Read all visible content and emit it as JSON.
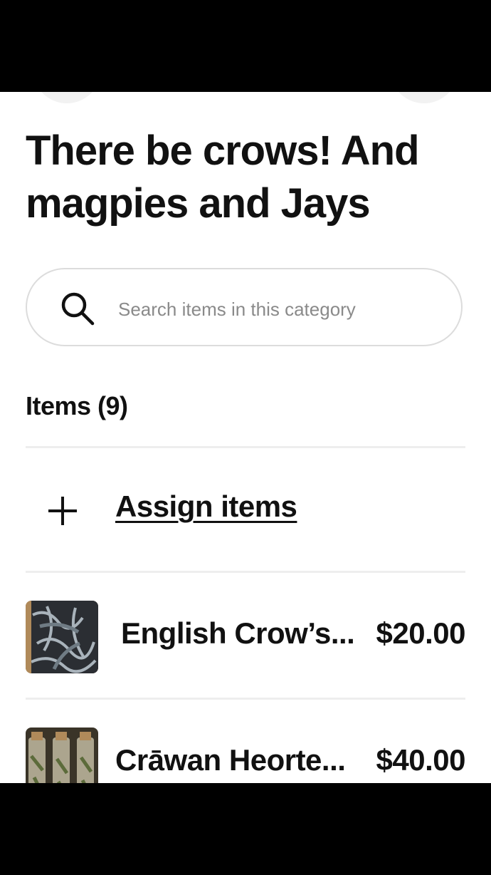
{
  "page": {
    "title": "There be crows! And magpies and Jays"
  },
  "search": {
    "placeholder": "Search items in this category",
    "value": ""
  },
  "items_section": {
    "heading": "Items (9)",
    "count": 9,
    "assign_label": "Assign items"
  },
  "items": [
    {
      "name": "English Crow’s...",
      "price": "$20.00"
    },
    {
      "name": "Crāwan Heorte...",
      "price": "$40.00"
    }
  ],
  "icons": {
    "search": "search-icon",
    "plus": "plus-icon"
  },
  "colors": {
    "text": "#111111",
    "placeholder": "#8a8a8a",
    "border": "#dcdcdc",
    "divider": "#eeeeee"
  }
}
